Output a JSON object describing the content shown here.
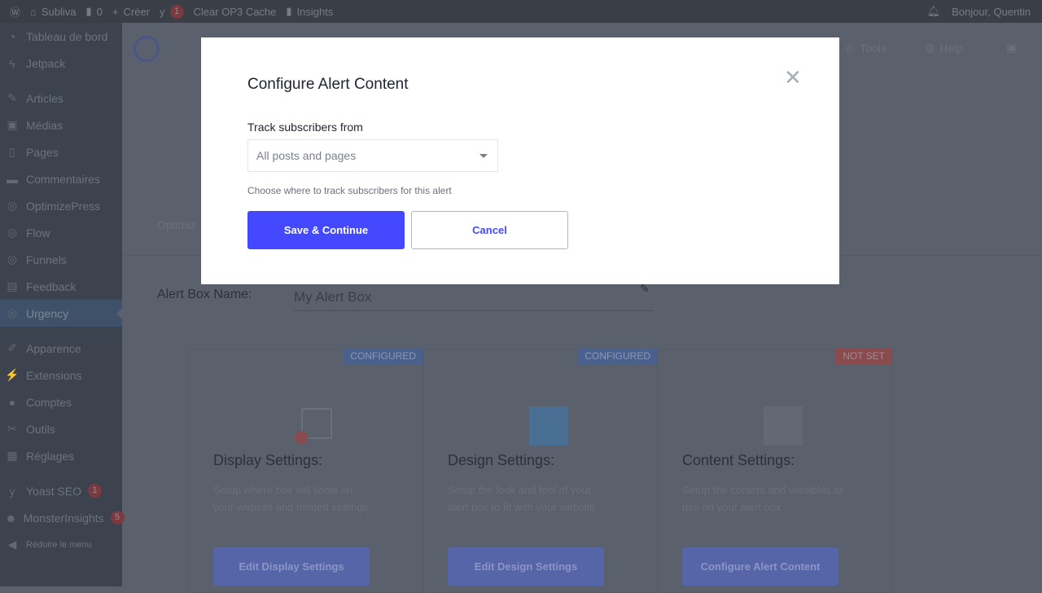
{
  "admin_bar": {
    "site": "Subliva",
    "comments": "0",
    "create": "Créer",
    "yoast_count": "1",
    "clear_cache": "Clear OP3 Cache",
    "insights": "Insights",
    "greeting": "Bonjour, Quentin"
  },
  "sidebar": {
    "items": [
      {
        "label": "Tableau de bord",
        "icon": "dashboard-icon"
      },
      {
        "label": "Jetpack",
        "icon": "jetpack-icon"
      },
      {
        "label": "Articles",
        "icon": "pin-icon"
      },
      {
        "label": "Médias",
        "icon": "media-icon"
      },
      {
        "label": "Pages",
        "icon": "pages-icon"
      },
      {
        "label": "Commentaires",
        "icon": "comment-icon"
      },
      {
        "label": "OptimizePress",
        "icon": "rocket-icon"
      },
      {
        "label": "Flow",
        "icon": "rocket-icon"
      },
      {
        "label": "Funnels",
        "icon": "rocket-icon"
      },
      {
        "label": "Feedback",
        "icon": "feedback-icon"
      },
      {
        "label": "Urgency",
        "icon": "rocket-icon",
        "active": true
      },
      {
        "label": "Apparence",
        "icon": "brush-icon"
      },
      {
        "label": "Extensions",
        "icon": "plugin-icon"
      },
      {
        "label": "Comptes",
        "icon": "user-icon"
      },
      {
        "label": "Outils",
        "icon": "wrench-icon"
      },
      {
        "label": "Réglages",
        "icon": "settings-icon"
      },
      {
        "label": "Yoast SEO",
        "icon": "yoast-icon",
        "badge": "1"
      },
      {
        "label": "MonsterInsights",
        "icon": "monster-icon",
        "badge": "5"
      }
    ],
    "collapse": "Réduire le menu"
  },
  "header": {
    "tools": "Tools",
    "help": "Help"
  },
  "main": {
    "tab_partial": "Optimiz",
    "alert_box_name_label": "Alert Box Name:",
    "alert_box_name": "My Alert Box",
    "cards": [
      {
        "status": "CONFIGURED",
        "title": "Display Settings:",
        "desc": "Setup where box will show on your website and related settings",
        "button": "Edit Display Settings"
      },
      {
        "status": "CONFIGURED",
        "title": "Design Settings:",
        "desc": "Setup the look and feel of your alert box to fit with your website",
        "button": "Edit Design Settings"
      },
      {
        "status": "NOT SET",
        "title": "Content Settings:",
        "desc": "Setup the content and variables to use on your alert box",
        "button": "Configure Alert Content"
      }
    ]
  },
  "modal": {
    "title": "Configure Alert Content",
    "field_label": "Track subscribers from",
    "select_value": "All posts and pages",
    "help": "Choose where to track subscribers for this alert",
    "save": "Save & Continue",
    "cancel": "Cancel"
  },
  "colors": {
    "primary": "#4449ff",
    "configured": "#49618c",
    "not_set": "#8a4b4f"
  }
}
